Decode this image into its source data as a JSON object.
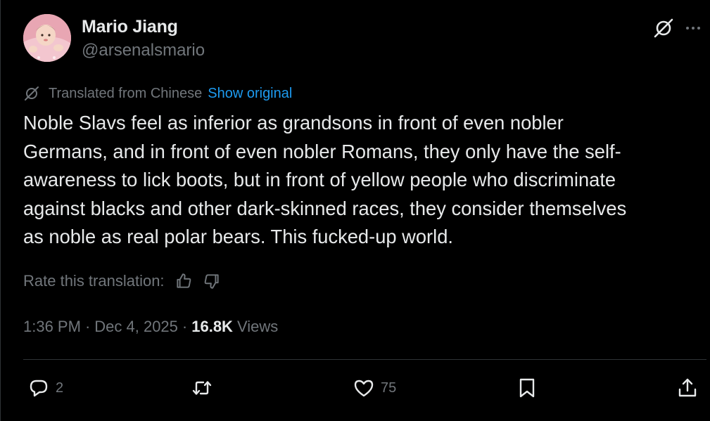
{
  "author": {
    "display_name": "Mario Jiang",
    "handle": "@arsenalsmario"
  },
  "header_icons": {
    "grok": "grok-icon",
    "more": "more-icon"
  },
  "translation": {
    "label": "Translated from Chinese",
    "show_original": "Show original",
    "rate_label": "Rate this translation:"
  },
  "tweet": {
    "text": "Noble Slavs feel as inferior as grandsons in front of even nobler\nGermans, and in front of even nobler Romans, they only have the self-\nawareness to lick boots, but in front of yellow people who discriminate\nagainst blacks and other dark-skinned races, they consider themselves\nas noble as real polar bears. This fucked-up world."
  },
  "meta": {
    "time": "1:36 PM",
    "separator": "·",
    "date": "Dec 4, 2025",
    "views_count": "16.8K",
    "views_label": "Views"
  },
  "actions": {
    "reply_count": "2",
    "retweet_count": "",
    "like_count": "75"
  },
  "colors": {
    "background": "#000000",
    "text": "#e7e9ea",
    "muted": "#71767b",
    "link": "#1d9bf0",
    "border": "#2f3336"
  }
}
